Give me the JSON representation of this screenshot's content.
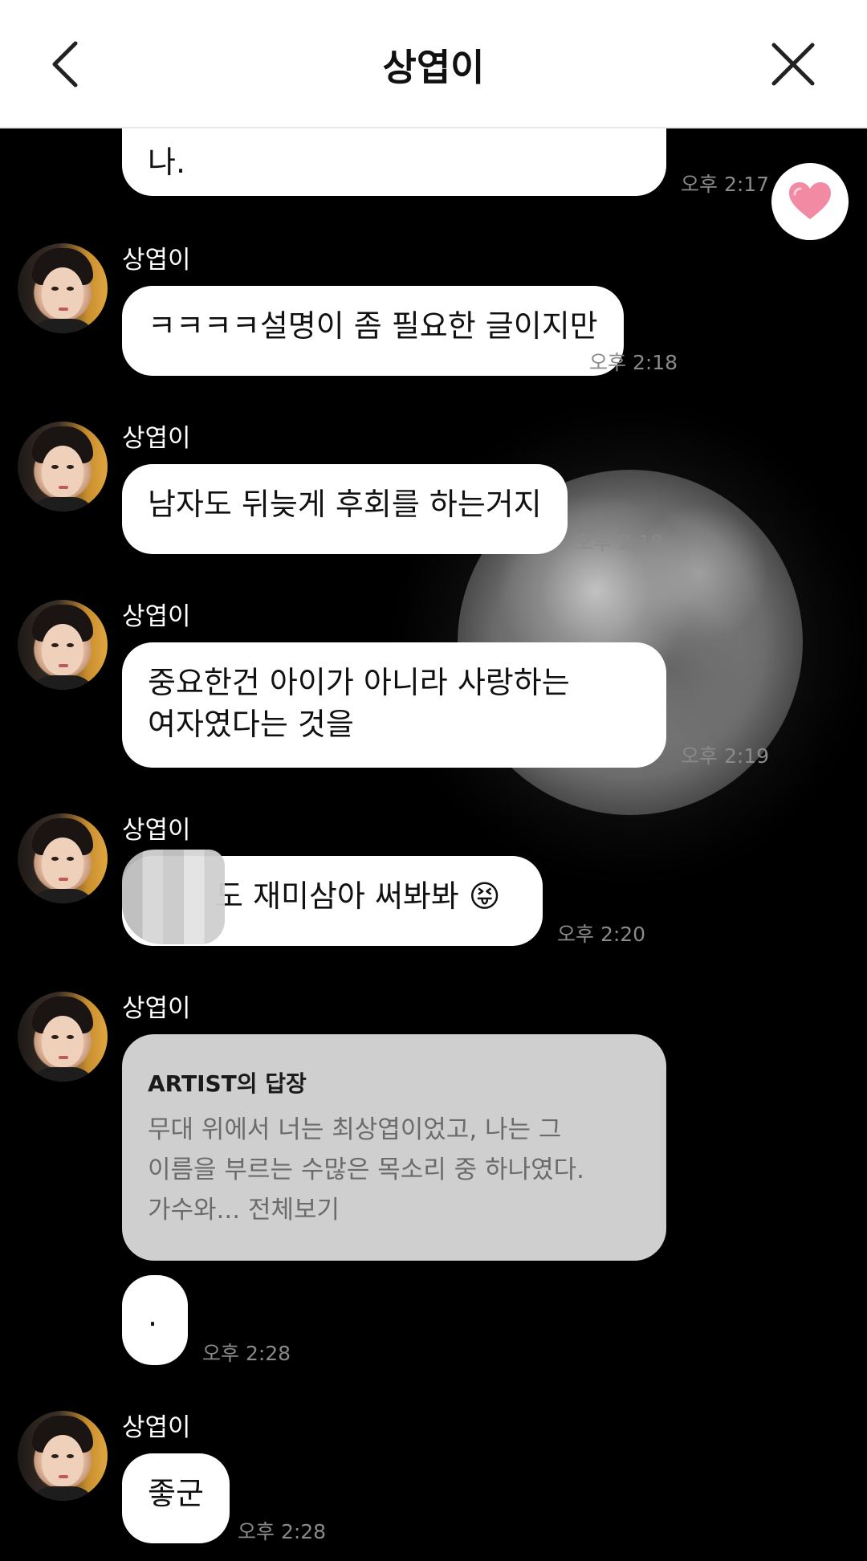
{
  "header": {
    "title": "상엽이"
  },
  "messages": [
    {
      "text": "나.",
      "time": "오후 2:17"
    },
    {
      "sender": "상엽이",
      "text": "ㅋㅋㅋㅋ설명이 좀 필요한 글이지만",
      "time": "오후 2:18"
    },
    {
      "sender": "상엽이",
      "text": "남자도 뒤늦게 후회를 하는거지",
      "time": "오후 2:18"
    },
    {
      "sender": "상엽이",
      "text_line1": "중요한건 아이가 아니라 사랑하는",
      "text_line2": "여자였다는 것을",
      "time": "오후 2:19"
    },
    {
      "sender": "상엽이",
      "text": "도 재미삼아 써봐봐 ",
      "emoji": "😝",
      "time": "오후 2:20"
    },
    {
      "sender": "상엽이",
      "reply_title": "ARTIST의 답장",
      "reply_line1": "무대 위에서 너는 최상엽이었고, 나는 그",
      "reply_line2": "이름을 부르는 수많은 목소리 중 하나였다.",
      "reply_line3": "가수와... 전체보기"
    },
    {
      "text": ".",
      "time": "오후 2:28"
    },
    {
      "sender": "상엽이",
      "text": "좋군",
      "time": "오후 2:28"
    }
  ],
  "colors": {
    "accent_heart": "#f28aa3",
    "background": "#000000",
    "bubble": "#ffffff",
    "reply_card": "#cfcfcf"
  },
  "icons": [
    "back-arrow-icon",
    "close-icon",
    "heart-icon"
  ]
}
